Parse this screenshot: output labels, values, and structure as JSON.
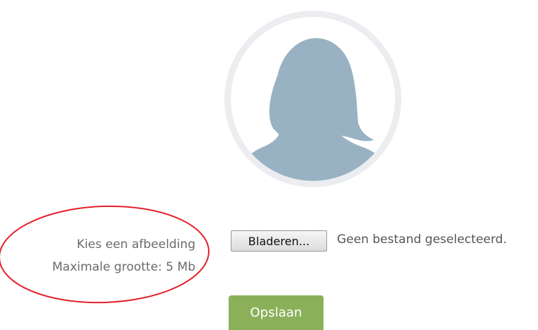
{
  "profile": {
    "avatar_icon": "person-silhouette-icon",
    "avatar_colors": {
      "ring": "#ecedf0",
      "figure": "#99b2c3"
    }
  },
  "upload": {
    "label": "Kies een afbeelding",
    "max_size": "Maximale grootte: 5 Mb",
    "browse_label": "Bladeren...",
    "status": "Geen bestand geselecteerd."
  },
  "actions": {
    "save_label": "Opslaan",
    "save_color": "#8ab15a"
  },
  "annotation": {
    "color": "#e3202b"
  }
}
